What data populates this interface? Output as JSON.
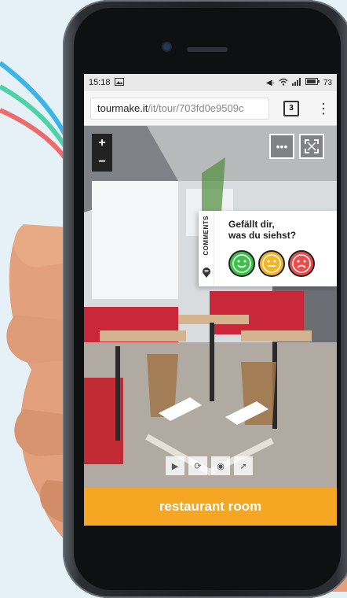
{
  "status_bar": {
    "time": "15:18",
    "battery": "73"
  },
  "browser": {
    "url_host": "tourmake.it",
    "url_path": "/it/tour/703fd0e9509c",
    "tab_count": "3"
  },
  "viewer": {
    "zoom_in": "+",
    "zoom_out": "−",
    "more_label": "•••"
  },
  "feedback": {
    "comments_label": "COMMENTS",
    "question_line1": "Gefällt dir,",
    "question_line2": "was du siehst?",
    "faces": [
      {
        "name": "happy",
        "color": "#3cc24a"
      },
      {
        "name": "neutral",
        "color": "#f5b325"
      },
      {
        "name": "sad",
        "color": "#ee4b4b"
      }
    ]
  },
  "tour": {
    "title": "restaurant room"
  },
  "colors": {
    "accent": "#f5a623"
  }
}
